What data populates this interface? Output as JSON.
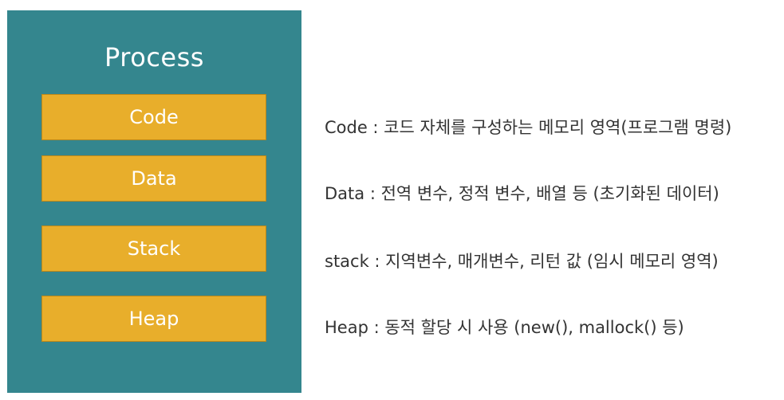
{
  "process": {
    "title": "Process",
    "segments": [
      {
        "label": "Code"
      },
      {
        "label": "Data"
      },
      {
        "label": "Stack"
      },
      {
        "label": "Heap"
      }
    ]
  },
  "descriptions": [
    {
      "text": "Code : 코드 자체를 구성하는 메모리 영역(프로그램 명령)"
    },
    {
      "text": "Data : 전역 변수, 정적 변수, 배열 등 (초기화된 데이터)"
    },
    {
      "text": "stack : 지역변수, 매개변수, 리턴 값 (임시 메모리 영역)"
    },
    {
      "text": "Heap : 동적 할당 시 사용 (new(), mallock() 등)"
    }
  ],
  "colors": {
    "process_bg": "#34868e",
    "segment_bg": "#e8ae2b",
    "description_text": "#333333"
  }
}
